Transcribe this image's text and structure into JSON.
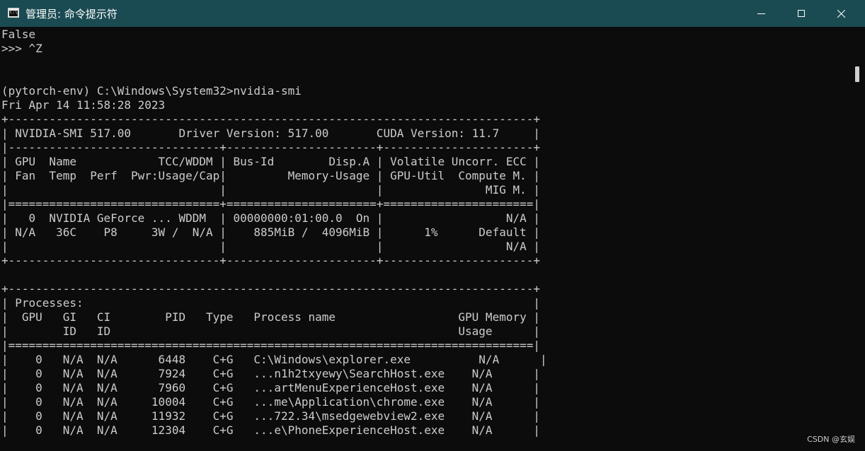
{
  "window": {
    "title": "管理员: 命令提示符",
    "app_icon": "cmd-icon",
    "controls": [
      "minimize-icon",
      "maximize-icon",
      "close-icon"
    ]
  },
  "console": {
    "lines": [
      "False",
      ">>> ^Z",
      "",
      "",
      "(pytorch-env) C:\\Windows\\System32>nvidia-smi",
      "Fri Apr 14 11:58:28 2023",
      "+-----------------------------------------------------------------------------+",
      "| NVIDIA-SMI 517.00       Driver Version: 517.00       CUDA Version: 11.7     |",
      "|-------------------------------+----------------------+----------------------+",
      "| GPU  Name            TCC/WDDM | Bus-Id        Disp.A | Volatile Uncorr. ECC |",
      "| Fan  Temp  Perf  Pwr:Usage/Cap|         Memory-Usage | GPU-Util  Compute M. |",
      "|                               |                      |               MIG M. |",
      "|===============================+======================+======================|",
      "|   0  NVIDIA GeForce ... WDDM  | 00000000:01:00.0  On |                  N/A |",
      "| N/A   36C    P8     3W /  N/A |    885MiB /  4096MiB |      1%      Default |",
      "|                               |                      |                  N/A |",
      "+-------------------------------+----------------------+----------------------+",
      "",
      "+-----------------------------------------------------------------------------+",
      "| Processes:                                                                  |",
      "|  GPU   GI   CI        PID   Type   Process name                  GPU Memory |",
      "|        ID   ID                                                   Usage      |",
      "|=============================================================================|",
      "|    0   N/A  N/A      6448    C+G   C:\\Windows\\explorer.exe          N/A      |",
      "|    0   N/A  N/A      7924    C+G   ...n1h2txyewy\\SearchHost.exe    N/A      |",
      "|    0   N/A  N/A      7960    C+G   ...artMenuExperienceHost.exe    N/A      |",
      "|    0   N/A  N/A     10004    C+G   ...me\\Application\\chrome.exe    N/A      |",
      "|    0   N/A  N/A     11932    C+G   ...722.34\\msedgewebview2.exe    N/A      |",
      "|    0   N/A  N/A     12304    C+G   ...e\\PhoneExperienceHost.exe    N/A      |"
    ]
  },
  "watermark": "CSDN @玄娱"
}
